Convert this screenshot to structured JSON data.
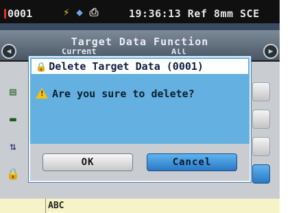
{
  "status_bar": {
    "sample_number": "0001",
    "clock": "19:36:13",
    "ref_label": "Ref",
    "aperture": "8mm",
    "mode": "SCE",
    "icons": [
      "battery-icon",
      "usb-icon",
      "save-icon"
    ]
  },
  "header": {
    "title": "Target Data Function",
    "tab_left": "Current",
    "tab_right": "All"
  },
  "dialog": {
    "title": "Delete Target Data (0001)",
    "message": "Are you sure to delete?",
    "ok_label": "OK",
    "cancel_label": "Cancel"
  },
  "bottom": {
    "label": "ABC"
  },
  "colors": {
    "dialog_bg": "#64b0e0",
    "cancel_button": "#2a78c4",
    "warning": "#f4c20d"
  }
}
